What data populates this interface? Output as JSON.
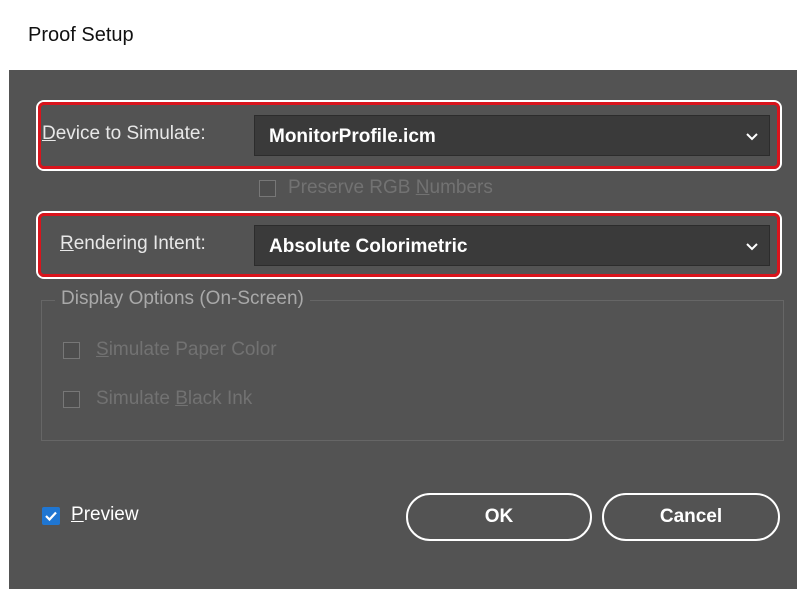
{
  "window": {
    "title": "Proof Setup"
  },
  "device": {
    "label_pre": "",
    "label_mnemonic": "D",
    "label_post": "evice to Simulate:",
    "value": "MonitorProfile.icm",
    "dropdown_icon": "chevron-down-icon"
  },
  "preserve": {
    "label_pre": "Preserve RGB ",
    "label_mnemonic": "N",
    "label_post": "umbers",
    "checked": false
  },
  "rendering": {
    "label_pre": "",
    "label_mnemonic": "R",
    "label_post": "endering Intent:",
    "value": "Absolute Colorimetric",
    "dropdown_icon": "chevron-down-icon"
  },
  "display_options": {
    "title": "Display Options (On-Screen)",
    "paper": {
      "label_pre": "",
      "label_mnemonic": "S",
      "label_post": "imulate Paper Color",
      "checked": false
    },
    "black": {
      "label_pre": "Simulate ",
      "label_mnemonic": "B",
      "label_post": "lack Ink",
      "checked": false
    }
  },
  "preview": {
    "label_pre": "",
    "label_mnemonic": "P",
    "label_post": "review",
    "checked": true
  },
  "buttons": {
    "ok": "OK",
    "cancel": "Cancel"
  },
  "colors": {
    "highlight": "#d9141c",
    "panel": "#535353",
    "checkbox_checked": "#1f76d2"
  }
}
